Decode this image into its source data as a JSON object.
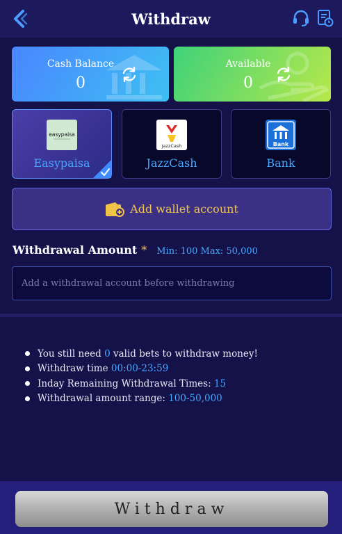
{
  "header": {
    "title": "Withdraw"
  },
  "balances": {
    "cash": {
      "label": "Cash Balance",
      "value": "0"
    },
    "available": {
      "label": "Available",
      "value": "0"
    }
  },
  "methods": [
    {
      "name": "Easypaisa",
      "logo_text": "easypaisa",
      "active": true
    },
    {
      "name": "JazzCash",
      "logo_text": "JazzCash",
      "active": false
    },
    {
      "name": "Bank",
      "logo_text": "Bank",
      "active": false
    }
  ],
  "add_wallet": {
    "label": "Add wallet account"
  },
  "amount": {
    "label": "Withdrawal Amount",
    "required_mark": "*",
    "range": "Min: 100 Max: 50,000",
    "placeholder": "Add a withdrawal account before withdrawing"
  },
  "tips": {
    "t1_pre": "You still need ",
    "t1_val": "0",
    "t1_post": " valid bets to withdraw money!",
    "t2_pre": "Withdraw time ",
    "t2_val": "00:00-23:59",
    "t3_pre": "Inday Remaining Withdrawal Times: ",
    "t3_val": "15",
    "t4_pre": "Withdrawal amount range: ",
    "t4_val": "100-50,000"
  },
  "footer": {
    "button_label": "Withdraw"
  },
  "colors": {
    "background": "#15124a",
    "accent_blue": "#47a7ff",
    "accent_gold": "#f0c449",
    "cash_card": "#4a86ff",
    "available_card": "#3fd27a"
  },
  "icons": {
    "back": "back-arrow-icon",
    "support": "headset-icon",
    "records": "records-icon",
    "refresh": "refresh-icon",
    "wallet": "wallet-add-icon",
    "check": "checkmark-icon"
  }
}
